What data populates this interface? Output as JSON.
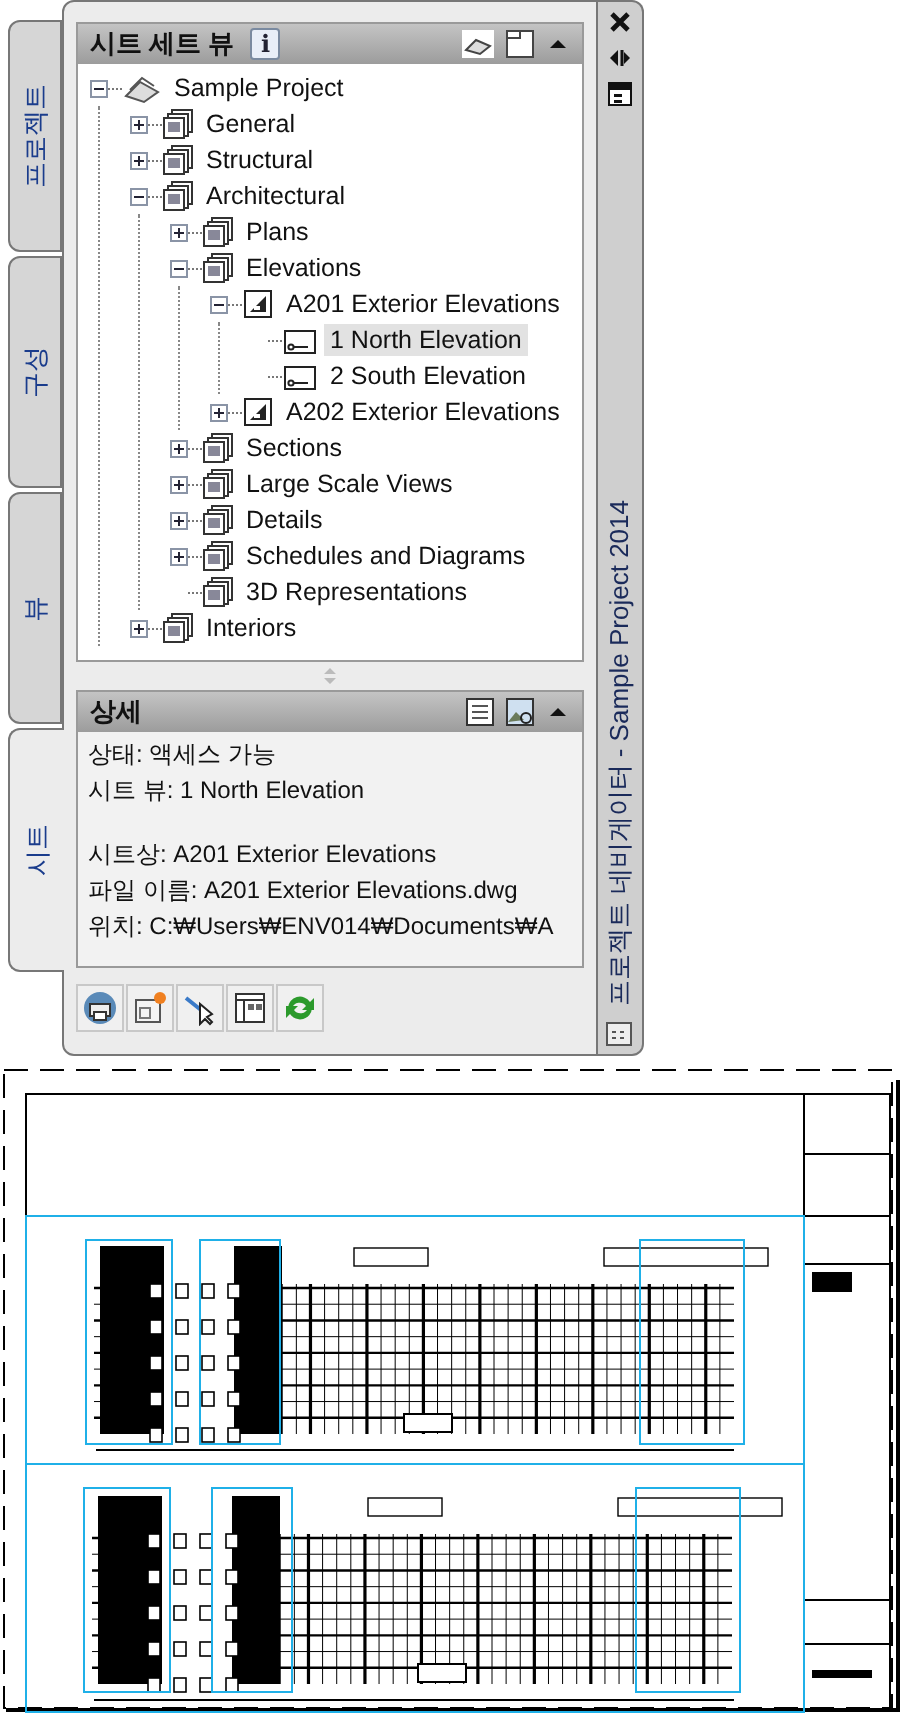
{
  "palette": {
    "side_tabs": [
      {
        "label": "프로젝트",
        "selected": false
      },
      {
        "label": "구성",
        "selected": false
      },
      {
        "label": "뷰",
        "selected": false
      },
      {
        "label": "시트",
        "selected": true
      }
    ],
    "title": "프로젝트 네비게이터 - Sample Project 2014",
    "sheet_set_view": {
      "title": "시트 세트 뷰",
      "info": "i",
      "tree": [
        {
          "label": "Sample Project",
          "kind": "project",
          "expanded": true,
          "selected": false,
          "children": [
            {
              "label": "General",
              "kind": "subset",
              "expanded": false,
              "selected": false
            },
            {
              "label": "Structural",
              "kind": "subset",
              "expanded": false,
              "selected": false
            },
            {
              "label": "Architectural",
              "kind": "subset",
              "expanded": true,
              "selected": false,
              "children": [
                {
                  "label": "Plans",
                  "kind": "subset",
                  "expanded": false,
                  "selected": false
                },
                {
                  "label": "Elevations",
                  "kind": "subset",
                  "expanded": true,
                  "selected": false,
                  "children": [
                    {
                      "label": "A201 Exterior Elevations",
                      "kind": "sheet",
                      "expanded": true,
                      "selected": false,
                      "children": [
                        {
                          "label": "1 North Elevation",
                          "kind": "view",
                          "selected": true
                        },
                        {
                          "label": "2 South Elevation",
                          "kind": "view",
                          "selected": false
                        }
                      ]
                    },
                    {
                      "label": "A202 Exterior Elevations",
                      "kind": "sheet",
                      "expanded": false,
                      "selected": false
                    }
                  ]
                },
                {
                  "label": "Sections",
                  "kind": "subset",
                  "expanded": false,
                  "selected": false
                },
                {
                  "label": "Large Scale Views",
                  "kind": "subset",
                  "expanded": false,
                  "selected": false
                },
                {
                  "label": "Details",
                  "kind": "subset",
                  "expanded": false,
                  "selected": false
                },
                {
                  "label": "Schedules and Diagrams",
                  "kind": "subset",
                  "expanded": false,
                  "selected": false
                },
                {
                  "label": "3D Representations",
                  "kind": "subset",
                  "selected": false
                }
              ]
            },
            {
              "label": "Interiors",
              "kind": "subset",
              "expanded": false,
              "selected": false
            }
          ]
        }
      ]
    },
    "details": {
      "title": "상세",
      "groups": [
        [
          "상태: 액세스 가능",
          "시트 뷰: 1 North Elevation"
        ],
        [
          "시트상: A201 Exterior Elevations",
          "파일 이름: A201 Exterior Elevations.dwg",
          "위치: C:₩Users₩ENV014₩Documents₩A"
        ]
      ]
    }
  }
}
